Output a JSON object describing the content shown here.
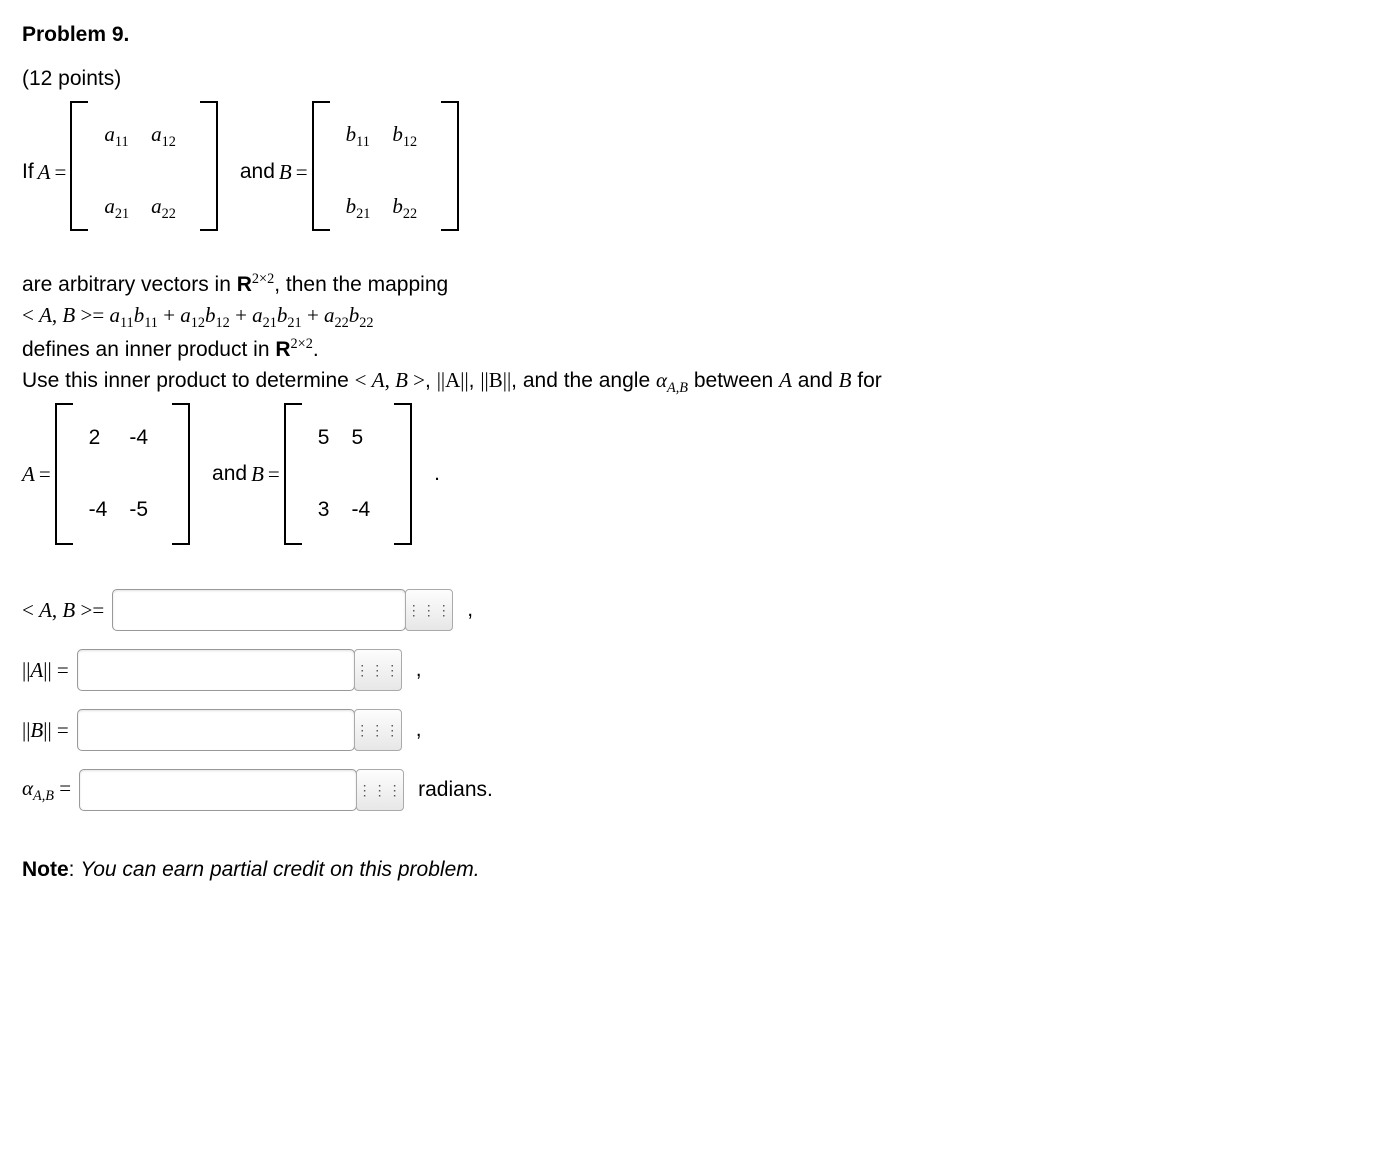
{
  "heading": "Problem 9.",
  "points": "(12 points)",
  "txt_ifA": "If ",
  "sym_A": "A",
  "sym_B": "B",
  "sym_eq": " = ",
  "txt_and": " and ",
  "matA_sym": {
    "a11": "a",
    "a12": "a",
    "a21": "a",
    "a22": "a",
    "s11": "11",
    "s12": "12",
    "s21": "21",
    "s22": "22"
  },
  "matB_sym": {
    "b11": "b",
    "b12": "b",
    "b21": "b",
    "b22": "b",
    "s11": "11",
    "s12": "12",
    "s21": "21",
    "s22": "22"
  },
  "line_arb1": "are arbitrary vectors in ",
  "R": "R",
  "exp2x2": "2×2",
  "line_arb2": ", then the mapping",
  "ip_lhs1": "< ",
  "ip_lhs2": ", ",
  "ip_lhs3": " >= ",
  "ip_terms": [
    "a",
    "b",
    " + ",
    "a",
    "b",
    " + ",
    "a",
    "b",
    " + ",
    "a",
    "b"
  ],
  "ip_subs": [
    "11",
    "11",
    "",
    "12",
    "12",
    "",
    "21",
    "21",
    "",
    "22",
    "22"
  ],
  "line_def": "defines an inner product in ",
  "period": ".",
  "line_use1": "Use this inner product to determine ",
  "expr_AB": "< A, B >",
  "comma": ", ",
  "normA": "||A||",
  "normB": "||B||",
  "line_use2": ", and the angle ",
  "alpha": "α",
  "alpha_sub": "A,B",
  "line_use3": " between ",
  "line_use4": " and ",
  "line_use5": " for",
  "matA_num": [
    "2",
    "-4",
    "-4",
    "-5"
  ],
  "matB_num": [
    "5",
    "5",
    "3",
    "-4"
  ],
  "ans_labels": {
    "ab": "< A, B >= ",
    "na": "||A|| = ",
    "nb": "||B|| = ",
    "ang_pre": "α",
    "ang_sub": "A,B",
    "ang_post": " = "
  },
  "trail_comma": ",",
  "trail_rad": "radians.",
  "keypad_glyph": "⋮⋮⋮",
  "note_label": "Note",
  "note_colon": ": ",
  "note_text": "You can earn partial credit on this problem.",
  "input_widths": {
    "ab": "280px",
    "na": "264px",
    "nb": "264px",
    "ang": "264px"
  }
}
